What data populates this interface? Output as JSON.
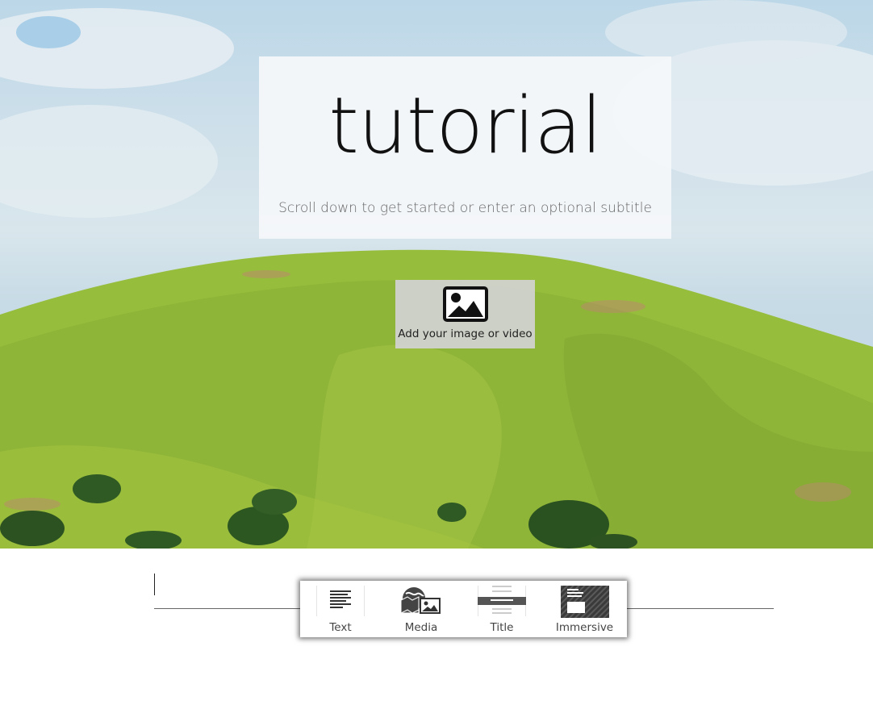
{
  "hero": {
    "title": "tutorial",
    "subtitle": "Scroll down to get started or enter an optional subtitle",
    "media_placeholder_label": "Add your image or video",
    "media_placeholder_icon": "image-icon"
  },
  "toolbar": {
    "items": [
      {
        "label": "Text",
        "icon": "text-block-icon"
      },
      {
        "label": "Media",
        "icon": "media-globe-icon"
      },
      {
        "label": "Title",
        "icon": "title-block-icon"
      },
      {
        "label": "Immersive",
        "icon": "immersive-block-icon"
      }
    ]
  },
  "colors": {
    "toolbar_bg": "#ffffff",
    "placeholder_bg": "#d2d2d2",
    "title_card_bg": "#f5f8fa",
    "hill_green": "#8fb83a"
  }
}
